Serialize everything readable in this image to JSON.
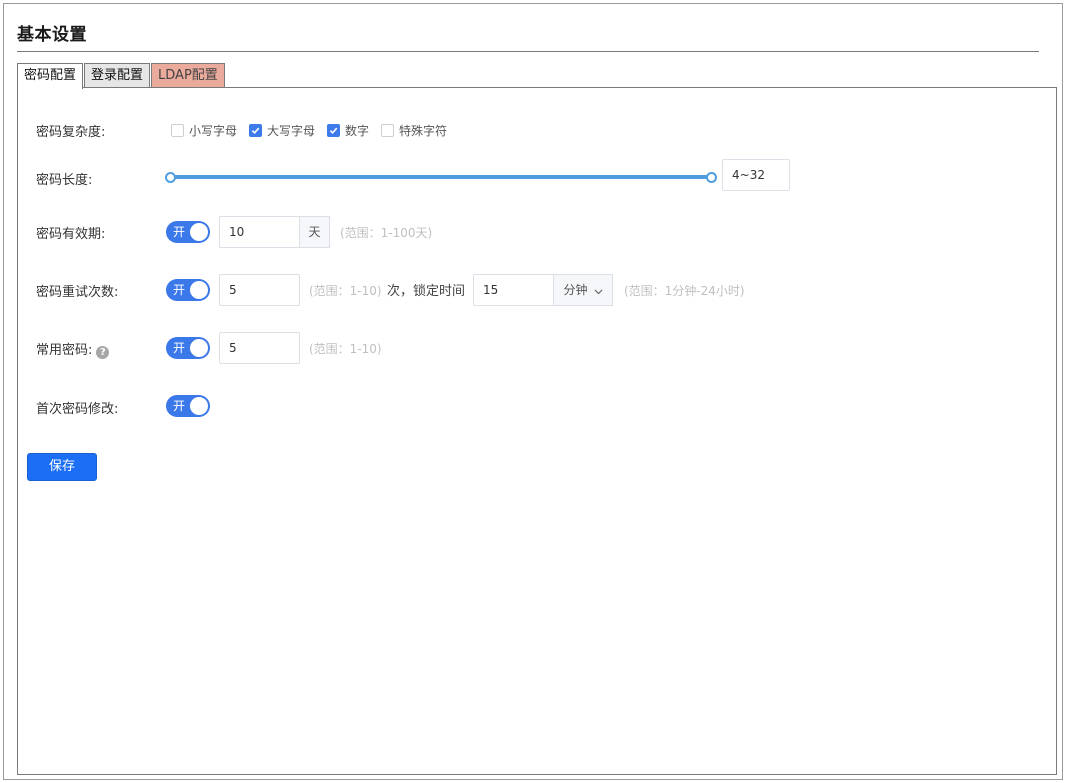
{
  "page": {
    "title": "基本设置"
  },
  "tabs": [
    {
      "label": "密码配置",
      "active": true
    },
    {
      "label": "登录配置",
      "active": false
    },
    {
      "label": "LDAP配置",
      "active": false
    }
  ],
  "complexity": {
    "label": "密码复杂度:",
    "options": [
      {
        "label": "小写字母",
        "checked": false
      },
      {
        "label": "大写字母",
        "checked": true
      },
      {
        "label": "数字",
        "checked": true
      },
      {
        "label": "特殊字符",
        "checked": false
      }
    ]
  },
  "length": {
    "label": "密码长度:",
    "min": 4,
    "max": 32,
    "value_text": "4~32"
  },
  "validity": {
    "label": "密码有效期:",
    "switch_label": "开",
    "value": "10",
    "unit": "天",
    "hint": "(范围：1-100天)"
  },
  "retry": {
    "label": "密码重试次数:",
    "switch_label": "开",
    "value": "5",
    "hint": "(范围：1-10)",
    "lock_text": "次，锁定时间",
    "lock_value": "15",
    "lock_unit": "分钟",
    "lock_hint": "(范围：1分钟-24小时)"
  },
  "common": {
    "label": "常用密码:",
    "switch_label": "开",
    "value": "5",
    "hint": "(范围：1-10)",
    "help_icon": "question-circle-icon"
  },
  "first_change": {
    "label": "首次密码修改:",
    "switch_label": "开"
  },
  "save_label": "保存",
  "colors": {
    "primary": "#1c6ff5",
    "switch_on": "#3b78ea",
    "slider": "#4f9ddf",
    "ldap_tab": "#eaaa9c"
  }
}
